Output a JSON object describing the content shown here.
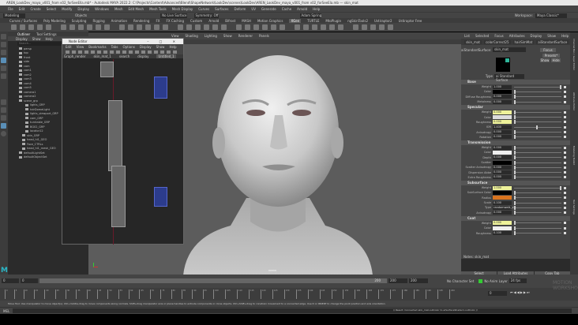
{
  "window": {
    "title": "AREN_LookDev_maya_v001_from v02_forSeeElla.mb* - Autodesk MAYA 2022.2: C:\\Projects\\Content\\Advanced\\Blend\\ShapeNetwork\\LookDev\\scenes\\LookDev\\AREN_LookDev_maya_v001_from v02_forSeeEla.mb --- skin_mat"
  },
  "menubar": [
    "File",
    "Edit",
    "Create",
    "Select",
    "Modify",
    "Display",
    "Windows",
    "Mesh",
    "Edit Mesh",
    "Mesh Tools",
    "Mesh Display",
    "Curves",
    "Surfaces",
    "Deform",
    "UV",
    "Generate",
    "Cache",
    "Arnold",
    "Help"
  ],
  "status": {
    "mode": "Modeling",
    "objects": "Objects",
    "surface": "No Live Surface",
    "symmetry": "Symmetry: Off",
    "camera": "Adam Spring",
    "workspace_label": "Workspace:",
    "workspace": "Maya Classic*"
  },
  "shelf_tabs": [
    "Curves / Surfaces",
    "Poly Modeling",
    "Sculpting",
    "Rigging",
    "Animation",
    "Rendering",
    "FX",
    "FX Caching",
    "Custom",
    "Arnold",
    "Bifrost",
    "MASH",
    "Motion Graphics",
    "XGen",
    "TURTLE",
    "MtoPlugin",
    "ngSkinTools2",
    "Ustiraptor2",
    "Ustiraptor Free"
  ],
  "shelf_active": "XGen",
  "outliner": {
    "tabs": [
      "Outliner",
      "Tool Settings"
    ],
    "menu": [
      "Display",
      "Show",
      "Help"
    ],
    "search_placeholder": "Search...",
    "items": [
      "persp",
      "top",
      "front",
      "side",
      "cam",
      "cam1",
      "cam2",
      "cam3",
      "cam4",
      "cam5",
      "camera1",
      "camera2",
      "scene_grp",
      "lights_GRP",
      "hdrDomeLight",
      "lights_viewport_GRP",
      "cam_GRP",
      "turntable_GRP",
      "BG02_GRP",
      "locator12",
      "skin_GRP",
      "head_hi1_GEO",
      "Face_CTRLs",
      "head_hi1_mesh_GEO",
      "defaultLightSet",
      "defaultObjectSet"
    ]
  },
  "viewport": {
    "menu": [
      "View",
      "Shading",
      "Lighting",
      "Show",
      "Renderer",
      "Panels"
    ],
    "camera_label": "persp"
  },
  "node_editor": {
    "title": "Node Editor",
    "menu": [
      "Edit",
      "View",
      "Bookmarks",
      "Tabs",
      "Options",
      "Display",
      "Show",
      "Help"
    ],
    "tab": "Untitled_1",
    "opt_fields": [
      "Graph_render",
      "skin_mat_1",
      "search",
      "display"
    ]
  },
  "attribute_editor": {
    "menu": [
      "List",
      "Selected",
      "Focus",
      "Attributes",
      "Display",
      "Show",
      "Help"
    ],
    "tabs": [
      "skin_mat",
      "colorCorrect25",
      "hairSimMat",
      "aiStandardSurface",
      "aiImage2"
    ],
    "node_type_label": "aiStandardSurface:",
    "node_name": "skin_mat",
    "buttons": {
      "focus": "Focus",
      "presets": "Presets*",
      "show": "Show",
      "hide": "Hide"
    },
    "type_label": "Type",
    "type_value": "ai Standard Surface",
    "sections": [
      {
        "title": "Base",
        "attrs": [
          {
            "label": "Weight",
            "value": "1.000"
          },
          {
            "label": "Color",
            "value": "",
            "color": "#000000"
          },
          {
            "label": "Diffuse Roughness",
            "value": "0.000"
          },
          {
            "label": "Metalness",
            "value": "0.000"
          }
        ]
      },
      {
        "title": "Specular",
        "attrs": [
          {
            "label": "Weight",
            "value": "0.000",
            "keyed": true
          },
          {
            "label": "Color",
            "value": "",
            "color": "#dddddd"
          },
          {
            "label": "Roughness",
            "value": "0.000",
            "keyed": true
          },
          {
            "label": "IOR",
            "value": "1.400"
          },
          {
            "label": "Anisotropy",
            "value": "0.000"
          },
          {
            "label": "Rotation",
            "value": "0.000"
          }
        ]
      },
      {
        "title": "Transmission",
        "attrs": [
          {
            "label": "Weight",
            "value": "0.000"
          },
          {
            "label": "Color",
            "value": "",
            "color": "#eeeeee"
          },
          {
            "label": "Depth",
            "value": "0.000"
          },
          {
            "label": "Scatter",
            "value": "",
            "color": "#000000"
          },
          {
            "label": "Scatter Anisotropy",
            "value": "0.000"
          },
          {
            "label": "Dispersion Abbe",
            "value": "0.000"
          },
          {
            "label": "Extra Roughness",
            "value": "0.000"
          }
        ]
      },
      {
        "title": "Subsurface",
        "attrs": [
          {
            "label": "Weight",
            "value": "1.000",
            "keyed": true
          },
          {
            "label": "SubSurface Color",
            "value": "",
            "color": "#000000"
          },
          {
            "label": "Radius",
            "value": "",
            "color": "#d9741f"
          },
          {
            "label": "Scale",
            "value": "0.100"
          },
          {
            "label": "Type",
            "value": "randomwalk_v2"
          },
          {
            "label": "Anisotropy",
            "value": "0.000"
          }
        ]
      },
      {
        "title": "Coat",
        "attrs": [
          {
            "label": "Weight",
            "value": "0.000",
            "keyed": true
          },
          {
            "label": "Color",
            "value": "",
            "color": "#eeeeee"
          },
          {
            "label": "Roughness",
            "value": "0.100"
          }
        ]
      }
    ],
    "notes": "Notes: skin_mat",
    "bottom_buttons": [
      "Select",
      "Load Attributes",
      "Copy Tab"
    ]
  },
  "right_strip": [
    "Channel Box / Layer Editor",
    "Attribute Editor",
    "Modeling Toolkit",
    "Tool Settings"
  ],
  "time": {
    "start": "0",
    "start2": "0",
    "range_end": "200",
    "end": "200",
    "end2": "200",
    "current": "0",
    "char_set": "No Character Set",
    "anim_layer": "No Anim Layer",
    "fps": "24 fps",
    "ticks": [
      "0",
      "5",
      "10",
      "15",
      "20",
      "25",
      "30",
      "35",
      "40",
      "45",
      "50",
      "55",
      "60",
      "65",
      "70",
      "75",
      "80",
      "85",
      "90",
      "95",
      "100",
      "105",
      "110",
      "115",
      "120",
      "125",
      "130",
      "135",
      "140",
      "145",
      "150",
      "155",
      "160",
      "165",
      "170",
      "175",
      "180",
      "185",
      "190",
      "195",
      "200"
    ]
  },
  "help_line": "Move Tool: Use manipulator to move object(s). Ctrl+middle-drag to move components along normals. Shift+drag manipulator axis or plane handles to extrude components or clone objects. Ctrl+Shift+drag to constrain movement to a connected edge. Use D or INSERT to change the pivot position and axis orientation.",
  "mel": {
    "label": "MEL",
    "result": "// Result: Connected skin_mat.outColor to aiSurfaceShader1.outColor //"
  },
  "watermark": "MOTION WORKSHOP"
}
